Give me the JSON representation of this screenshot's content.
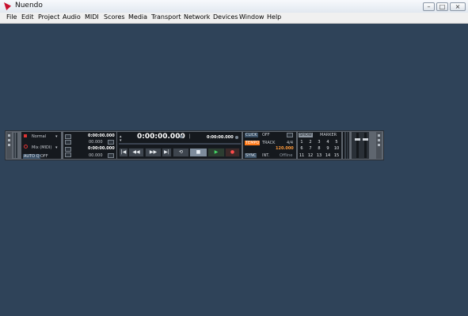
{
  "window": {
    "title": "Nuendo",
    "controls": {
      "minimize": "–",
      "maximize": "□",
      "close": "×"
    }
  },
  "menu": [
    "File",
    "Edit",
    "Project",
    "Audio",
    "MIDI",
    "Scores",
    "Media",
    "Transport",
    "Network",
    "Devices",
    "Window",
    "Help"
  ],
  "transport": {
    "performance": {
      "left_label": "Normal",
      "mode_label": "Mix (MIDI)",
      "auto_label": "AUTO Q",
      "auto_value": "OFF"
    },
    "locators": {
      "left_time": "0:00:00.000",
      "left_sub": "00.000",
      "right_time": "0:00:00.000",
      "right_sub": "00.000"
    },
    "primary_time": "0:00:00.000",
    "secondary_time": "0:00:00.000",
    "buttons": {
      "to_start": "|◀",
      "rewind": "◀◀",
      "forward": "▶▶",
      "to_end": "▶|",
      "cycle": "⟲",
      "stop": "■",
      "play": "▶",
      "record": "●"
    },
    "click": {
      "label": "CLICK",
      "value": "OFF"
    },
    "tempo": {
      "label": "TEMPO",
      "mode": "TRACK",
      "signature": "4/4",
      "bpm": "120.000"
    },
    "sync": {
      "label": "SYNC",
      "mode": "INT.",
      "status": "Offline"
    },
    "markers": {
      "show_label": "SHOW",
      "marker_label": "MARKER",
      "numbers": [
        "1",
        "2",
        "3",
        "4",
        "5",
        "6",
        "7",
        "8",
        "9",
        "10",
        "11",
        "12",
        "13",
        "14",
        "15"
      ]
    }
  },
  "colors": {
    "workspace": "#2f4359",
    "transport_panel": "#5f666f",
    "display": "#15191e",
    "tempo_accent": "#ff7a1a",
    "bpm_text": "#ff9a3a",
    "play_green": "#44d765",
    "record_red": "#ff4c4c"
  }
}
